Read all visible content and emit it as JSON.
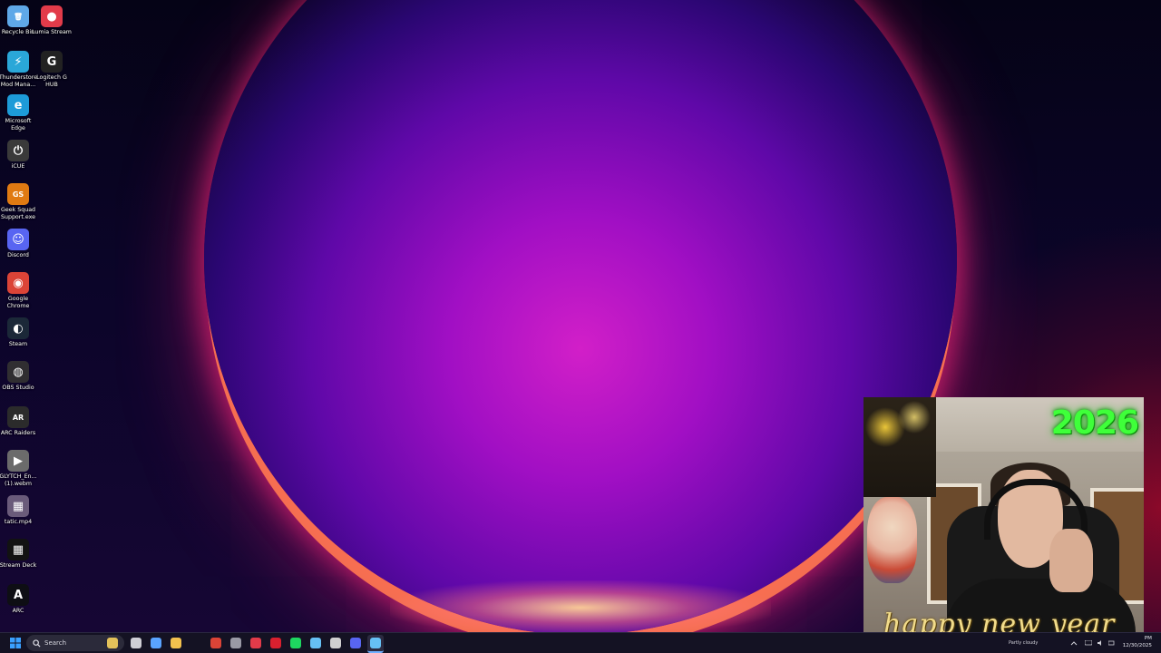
{
  "desktop": {
    "icons": [
      {
        "label": "Recycle Bin",
        "icon": "recycle-bin-icon",
        "glyph": "🗑",
        "color": "#5fa8e8"
      },
      {
        "label": "Lumia Stream",
        "icon": "lumia-stream-icon",
        "glyph": "●",
        "color": "#e23b4a"
      },
      {
        "label": "Thunderstore Mod Mana...",
        "icon": "thunderstore-icon",
        "glyph": "⚡",
        "color": "#2aa7d8"
      },
      {
        "label": "Logitech G HUB",
        "icon": "logitech-g-hub-icon",
        "glyph": "G",
        "color": "#222222"
      },
      {
        "label": "Microsoft Edge",
        "icon": "edge-icon",
        "glyph": "e",
        "color": "#1d9bd8"
      },
      {
        "label": "iCUE",
        "icon": "icue-icon",
        "glyph": "⏻",
        "color": "#3a3a3a"
      },
      {
        "label": "Geek Squad Support.exe",
        "icon": "geek-squad-icon",
        "glyph": "GS",
        "color": "#e07a12"
      },
      {
        "label": "Discord",
        "icon": "discord-icon",
        "glyph": "☺",
        "color": "#5865f2"
      },
      {
        "label": "Google Chrome",
        "icon": "chrome-icon",
        "glyph": "◉",
        "color": "#db4437"
      },
      {
        "label": "Steam",
        "icon": "steam-icon",
        "glyph": "◐",
        "color": "#1b2838"
      },
      {
        "label": "OBS Studio",
        "icon": "obs-studio-icon",
        "glyph": "◍",
        "color": "#302e31"
      },
      {
        "label": "ARC Raiders",
        "icon": "arc-raiders-icon",
        "glyph": "AR",
        "color": "#2b2b2b"
      },
      {
        "label": "GLYTCH_En... (1).webm",
        "icon": "video-file-icon",
        "glyph": "▶",
        "color": "#6b6b6b"
      },
      {
        "label": "tatic.mp4",
        "icon": "video-file-icon",
        "glyph": "▦",
        "color": "#6a5b7a"
      },
      {
        "label": "Stream Deck",
        "icon": "stream-deck-icon",
        "glyph": "▦",
        "color": "#121212"
      },
      {
        "label": "ARC",
        "icon": "arc-icon",
        "glyph": "A",
        "color": "#0e0e14"
      }
    ]
  },
  "webcam": {
    "year_text": "2026",
    "greeting_text": "happy new year"
  },
  "taskbar": {
    "search_placeholder": "Search",
    "pinned": [
      {
        "icon": "file-explorer-widget-icon",
        "color": "#e3c15a"
      },
      {
        "icon": "task-view-icon",
        "color": "#cfcfd6"
      },
      {
        "icon": "copilot-icon",
        "color": "#5aa4ff"
      },
      {
        "icon": "folder-icon",
        "color": "#f2c14e"
      },
      {
        "icon": "chrome-icon",
        "color": "#db4437"
      },
      {
        "icon": "app-icon",
        "color": "#9a9aa5"
      },
      {
        "icon": "lumia-stream-icon",
        "color": "#e23b4a"
      },
      {
        "icon": "app-red-icon",
        "color": "#d8202f"
      },
      {
        "icon": "spotify-icon",
        "color": "#1ed760"
      },
      {
        "icon": "steam-icon",
        "color": "#66c0f4"
      },
      {
        "icon": "logitech-g-hub-icon",
        "color": "#d0d0d0"
      },
      {
        "icon": "discord-icon",
        "color": "#5865f2"
      },
      {
        "icon": "steam-active-icon",
        "color": "#66c0f4"
      }
    ],
    "weather": "Partly cloudy",
    "time": "PM",
    "date": "12/30/2025"
  }
}
